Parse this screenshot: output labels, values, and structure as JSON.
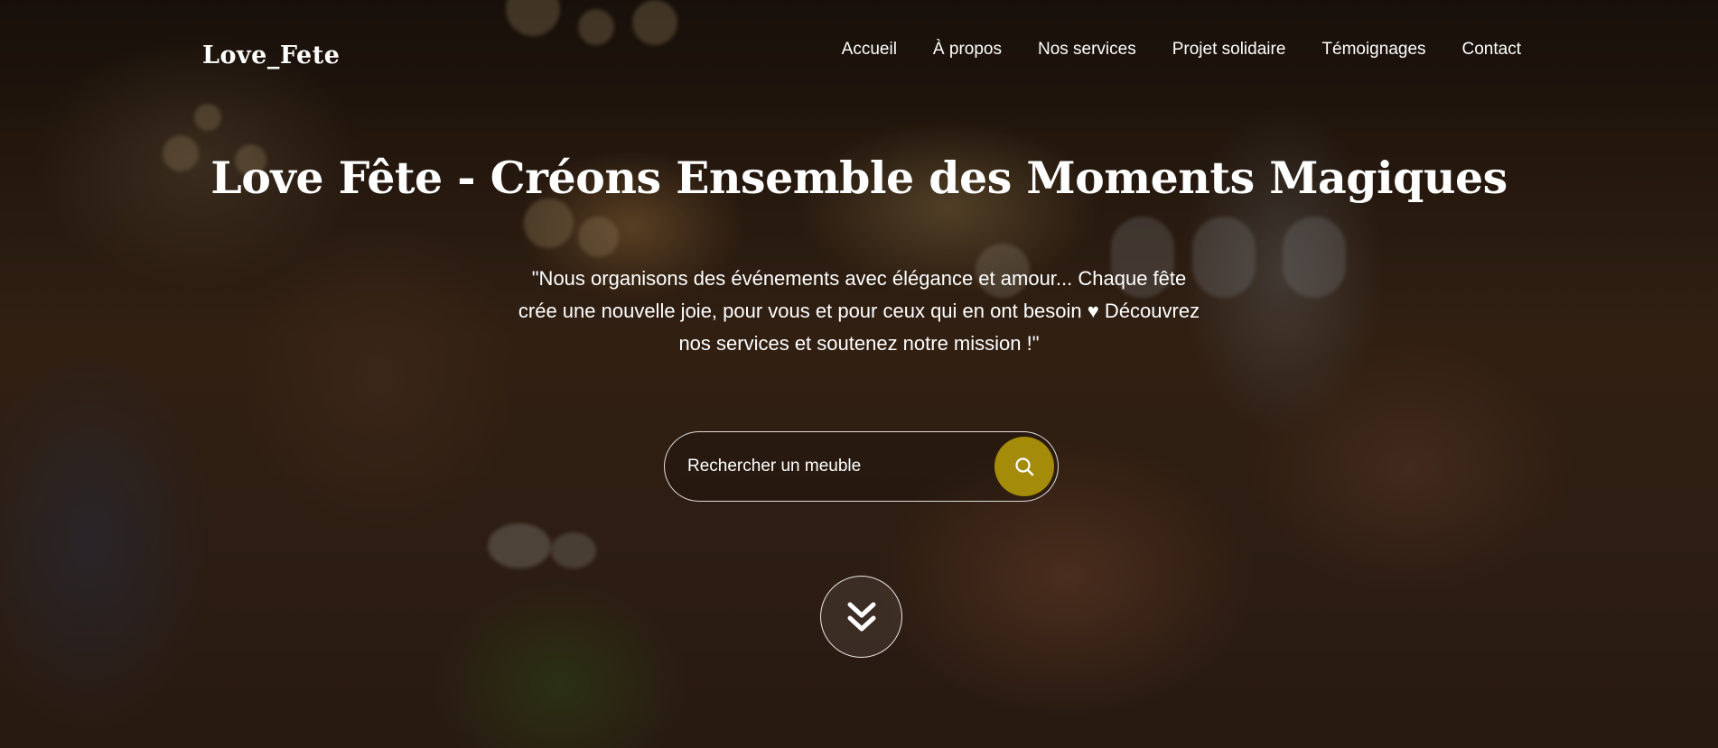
{
  "brand": {
    "logo_text": "Love_Fete"
  },
  "nav": {
    "items": [
      {
        "label": "Accueil"
      },
      {
        "label": "À propos"
      },
      {
        "label": "Nos services"
      },
      {
        "label": "Projet solidaire"
      },
      {
        "label": "Témoignages"
      },
      {
        "label": "Contact"
      }
    ]
  },
  "hero": {
    "title": "Love Fête - Créons Ensemble des Moments Magiques",
    "quote": "\"Nous organisons des événements avec élégance et amour... Chaque fête crée une nouvelle joie, pour vous et pour ceux qui en ont besoin ♥ Découvrez nos services et soutenez notre mission !\""
  },
  "search": {
    "placeholder": "Rechercher un meuble",
    "value": "",
    "button_icon": "search-icon",
    "button_color": "#a48b09"
  },
  "scroll": {
    "icon": "double-chevron-down-icon"
  }
}
